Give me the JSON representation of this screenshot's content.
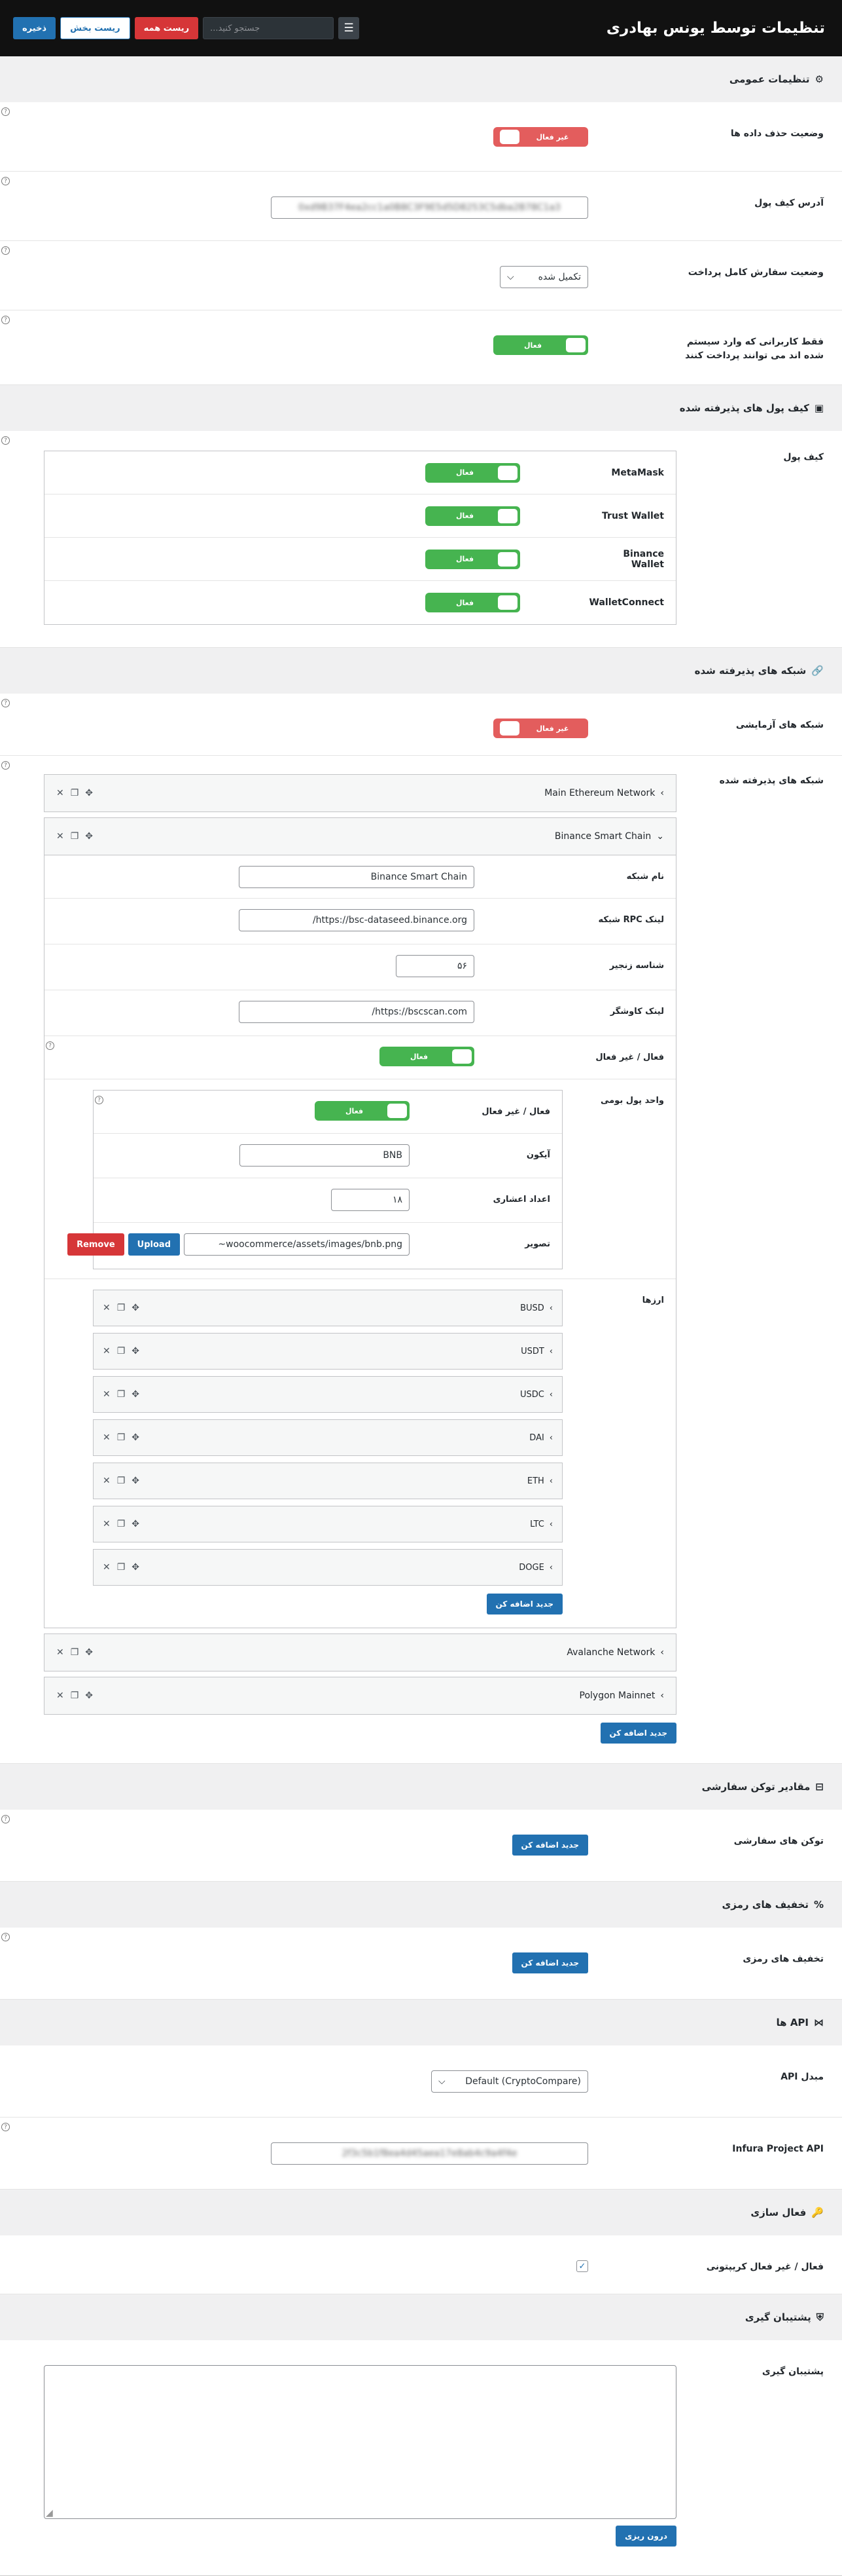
{
  "header": {
    "title": "تنظیمات توسط یونس بهادری",
    "search_placeholder": "جستجو کنید...",
    "save_label": "ذخیره",
    "reset_section_label": "ریست بخش",
    "reset_all_label": "ریست همه"
  },
  "toggle_on": "فعال",
  "toggle_off": "غیر فعال",
  "general": {
    "title": "تنظیمات عمومی",
    "delete_data_label": "وضعیت حذف داده ها",
    "wallet_address_label": "آدرس کیف پول",
    "wallet_address_value": "0xd9B37F4ea2cc1a0B8C3F9E5d5D8253C5dba2B78C1a3",
    "order_status_label": "وضعیت سفارش کامل پرداخت",
    "order_status_value": "تکمیل شده",
    "logged_in_label": "فقط کاربرانی که وارد سیستم شده اند می توانند پرداخت کنند"
  },
  "wallets": {
    "title": "کیف پول های پذیرفته شده",
    "label": "کیف پول",
    "items": [
      {
        "name": "MetaMask"
      },
      {
        "name": "Trust Wallet"
      },
      {
        "name": "Binance Wallet"
      },
      {
        "name": "WalletConnect"
      }
    ]
  },
  "networks": {
    "title": "شبکه های پذیرفته شده",
    "testnet_label": "شبکه های آزمایشی",
    "accepted_label": "شبکه های پذیرفته شده",
    "main_eth": "Main Ethereum Network",
    "bsc": {
      "title": "Binance Smart Chain",
      "name_label": "نام شبکه",
      "name_value": "Binance Smart Chain",
      "rpc_label": "لینک RPC شبکه",
      "rpc_value": "https://bsc-dataseed.binance.org/",
      "chain_label": "شناسه زنجیر",
      "chain_value": "۵۶",
      "explorer_label": "لینک کاوشگر",
      "explorer_value": "https://bscscan.com/",
      "active_label": "فعال / غیر فعال",
      "currency_label": "واحد پول بومی",
      "currency": {
        "active_label": "فعال / غیر فعال",
        "symbol_label": "آیکون",
        "symbol_value": "BNB",
        "decimals_label": "اعداد اعشاری",
        "decimals_value": "۱۸",
        "image_label": "تصویر",
        "image_value": "woocommerce/assets/images/bnb.png~",
        "upload": "Upload",
        "remove": "Remove"
      },
      "tokens_label": "ارزها",
      "tokens": [
        "BUSD",
        "USDT",
        "USDC",
        "DAI",
        "ETH",
        "LTC",
        "DOGE"
      ],
      "add_label": "جدید اضافه کن"
    },
    "avalanche": "Avalanche Network",
    "polygon": "Polygon Mainnet",
    "add_label": "جدید اضافه کن"
  },
  "custom_tokens": {
    "title": "مقادیر توکن سفارشی",
    "label": "توکن های سفارشی",
    "add_label": "جدید اضافه کن"
  },
  "discounts": {
    "title": "تخفیف های رمزی",
    "label": "تخفیف های رمزی",
    "add_label": "جدید اضافه کن"
  },
  "api": {
    "title": "API ها",
    "converter_label": "مبدل API",
    "converter_value": "Default (CryptoCompare)",
    "infura_label": "Infura Project API",
    "infura_value": "2f3c5b1f8ea4d45aea17e8ab4c9a4f4e"
  },
  "activation": {
    "title": "فعال سازی",
    "label": "فعال / غیر فعال کریپتونی",
    "checked": true
  },
  "backup": {
    "title": "پشتیبان گیری",
    "label": "پشتیبان گیری",
    "button": "درون ریزی"
  }
}
